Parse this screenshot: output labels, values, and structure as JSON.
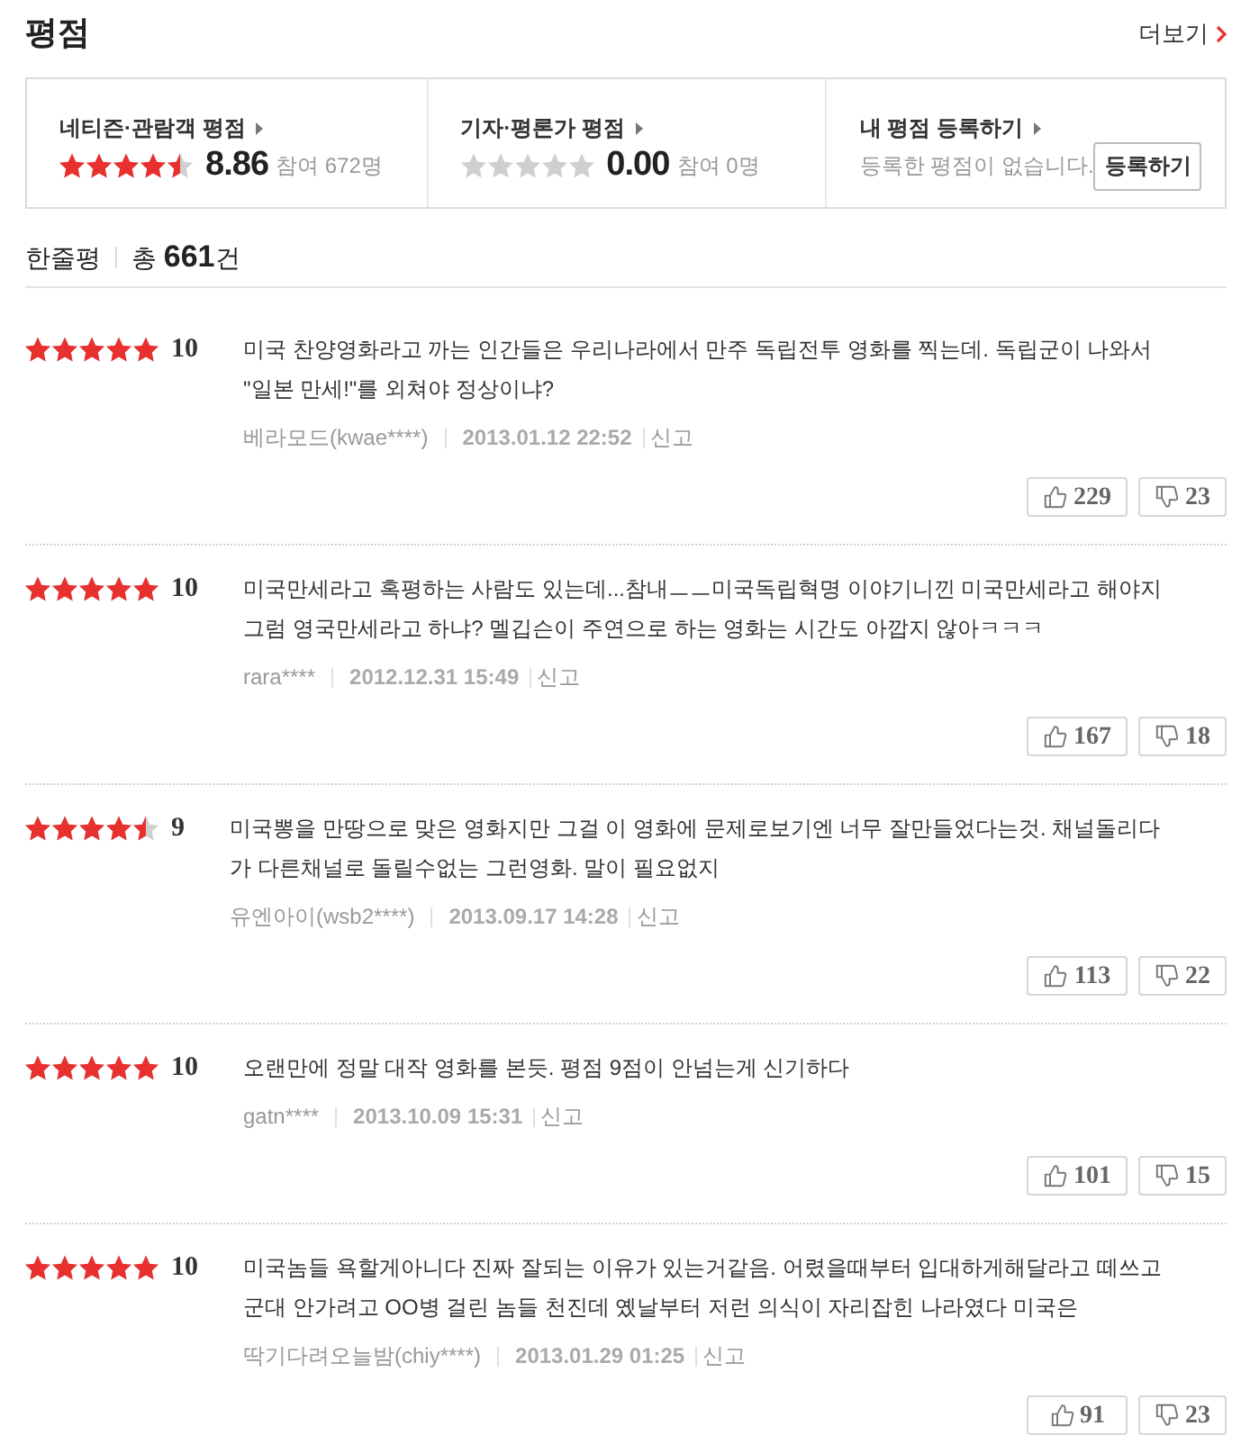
{
  "section": {
    "title": "평점",
    "more_link": "더보기"
  },
  "rating_summary": [
    {
      "kind": "score",
      "label": "네티즌·관람객 평점",
      "stars": 4.5,
      "score": "8.86",
      "participants": "참여 672명"
    },
    {
      "kind": "score",
      "label": "기자·평론가 평점",
      "stars": 0,
      "score": "0.00",
      "participants": "참여 0명"
    },
    {
      "kind": "register",
      "label": "내 평점 등록하기",
      "message": "등록한 평점이 없습니다.",
      "button": "등록하기"
    }
  ],
  "comments_header": {
    "title": "한줄평",
    "total": "총 **661**건"
  },
  "comments": [
    {
      "stars": 5,
      "score": "10",
      "text": "미국 찬양영화라고 까는 인간들은 우리나라에서 만주 독립전투 영화를 찍는데. 독립군이 나와서 \"일본 만세!\"를 외쳐야 정상이냐?",
      "author": "베라모드(kwae****)",
      "date": "2013.01.12 22:52",
      "report": "신고",
      "likes": "229",
      "dislikes": "23"
    },
    {
      "stars": 5,
      "score": "10",
      "text": "미국만세라고 혹평하는 사람도 있는데...참내ㅡㅡ미국독립혁명 이야기니낀 미국만세라고 해야지 그럼 영국만세라고 하냐? 멜깁슨이 주연으로 하는 영화는 시간도 아깝지 않아ㅋㅋㅋ",
      "author": "rara****",
      "date": "2012.12.31 15:49",
      "report": "신고",
      "likes": "167",
      "dislikes": "18"
    },
    {
      "stars": 4.5,
      "score": "9",
      "text": "미국뽕을 만땅으로 맞은 영화지만 그걸 이 영화에 문제로보기엔 너무 잘만들었다는것. 채널돌리다가 다른채널로 돌릴수없는 그런영화. 말이 필요없지",
      "author": "유엔아이(wsb2****)",
      "date": "2013.09.17 14:28",
      "report": "신고",
      "likes": "113",
      "dislikes": "22"
    },
    {
      "stars": 5,
      "score": "10",
      "text": "오랜만에 정말 대작 영화를 본듯. 평점 9점이 안넘는게 신기하다",
      "author": "gatn****",
      "date": "2013.10.09 15:31",
      "report": "신고",
      "likes": "101",
      "dislikes": "15"
    },
    {
      "stars": 5,
      "score": "10",
      "text": "미국놈들 욕할게아니다 진짜 잘되는 이유가 있는거같음. 어렸을때부터 입대하게해달라고 떼쓰고 군대 안가려고 OO병 걸린 놈들 천진데 옜날부터 저런 의식이 자리잡힌 나라였다 미국은",
      "author": "딱기다려오늘밤(chiy****)",
      "date": "2013.01.29 01:25",
      "report": "신고",
      "likes": "91",
      "dislikes": "23"
    }
  ]
}
